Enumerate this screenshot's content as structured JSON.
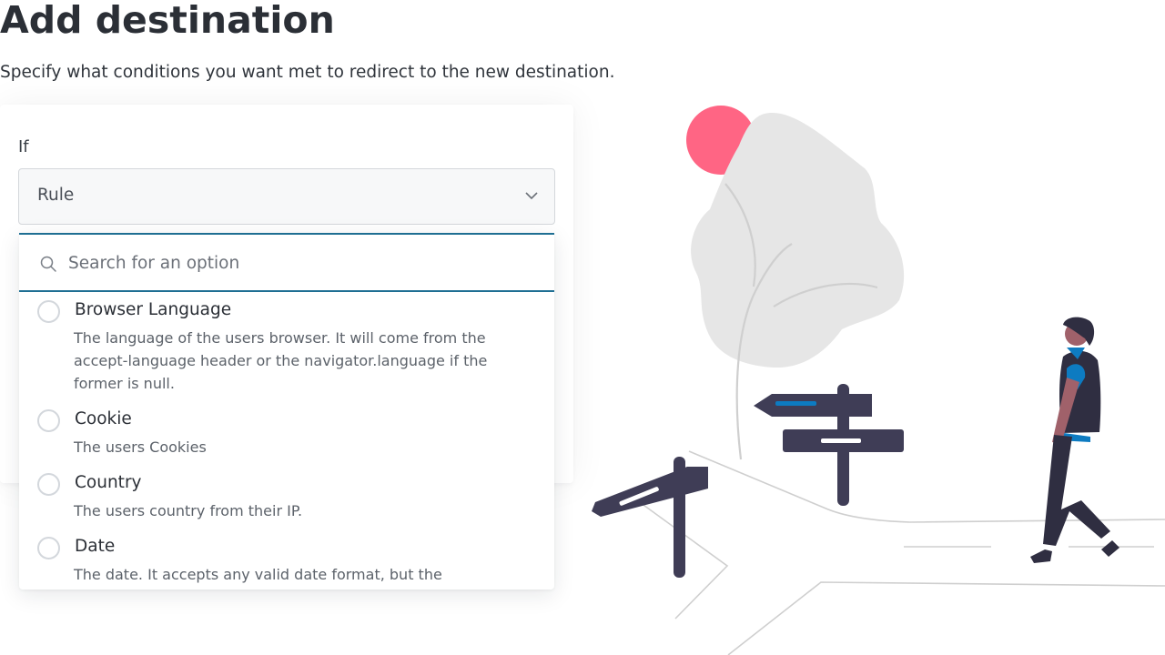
{
  "page": {
    "title": "Add destination",
    "subtitle": "Specify what conditions you want met to redirect to the new destination."
  },
  "form": {
    "if_label": "If",
    "rule_select": {
      "value": "Rule",
      "icon": "chevron-down-icon"
    }
  },
  "dropdown": {
    "search": {
      "placeholder": "Search for an option",
      "value": "",
      "icon": "search-icon"
    },
    "options": [
      {
        "title": "Browser Language",
        "description": "The language of the users browser. It will come from the accept-language header or the navigator.language if the former is null."
      },
      {
        "title": "Cookie",
        "description": "The users Cookies"
      },
      {
        "title": "Country",
        "description": "The users country from their IP."
      },
      {
        "title": "Date",
        "description": "The date. It accepts any valid date format, but the"
      }
    ]
  },
  "colors": {
    "accent": "#1f6f93",
    "sun": "#ff6584",
    "signpost": "#3f3d56",
    "tree": "#e6e6e6",
    "shirt": "#0d7bc1"
  }
}
